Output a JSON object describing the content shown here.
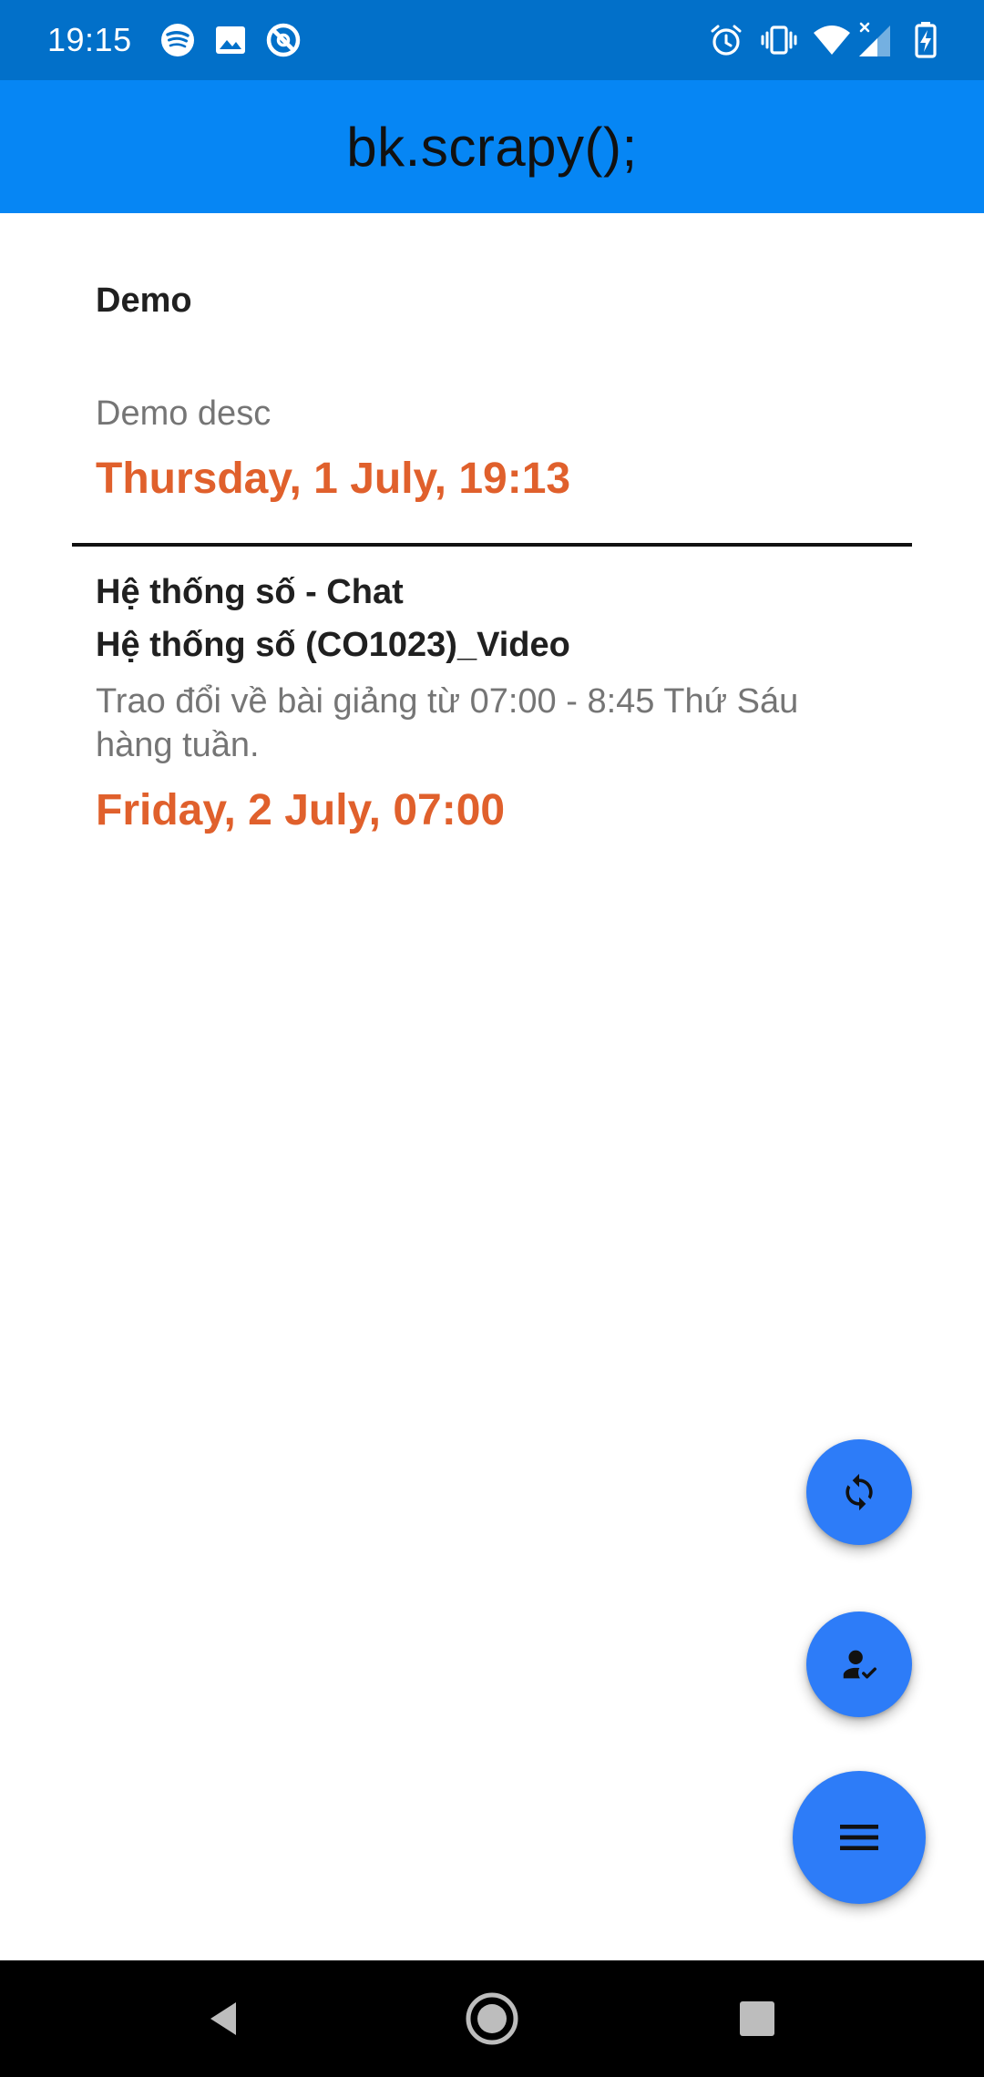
{
  "status_bar": {
    "time": "19:15",
    "left_icons": [
      "spotify-icon",
      "image-icon",
      "app-notification-icon"
    ],
    "right_icons": [
      "alarm-icon",
      "vibrate-icon",
      "wifi-icon",
      "signal-icon",
      "battery-charging-icon"
    ]
  },
  "app_bar": {
    "title": "bk.scrapy();"
  },
  "items": [
    {
      "title": "Demo",
      "description": "Demo desc",
      "date": "Thursday, 1 July, 19:13"
    },
    {
      "title_line1": "Hệ thống số - Chat",
      "title_line2": "Hệ thống số (CO1023)_Video",
      "description": "Trao đổi về bài giảng từ 07:00 - 8:45 Thứ Sáu hàng tuần.",
      "date": "Friday, 2 July, 07:00"
    }
  ],
  "fabs": {
    "refresh": "refresh-icon",
    "account": "account-check-icon",
    "menu": "menu-icon"
  },
  "colors": {
    "status_bar": "#0270c9",
    "app_bar": "#0686f4",
    "date_accent": "#e0602c",
    "fab": "#2d7cf8"
  }
}
